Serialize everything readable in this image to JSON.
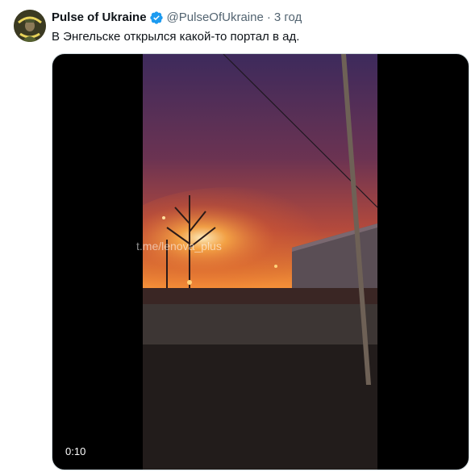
{
  "tweet": {
    "display_name": "Pulse of Ukraine",
    "handle": "@PulseOfUkraine",
    "separator": "·",
    "timestamp": "3 год",
    "verified": true,
    "text": "В Энгельске открылся какой-то портал в ад.",
    "avatar_icon": "soldier-portrait-avatar"
  },
  "media": {
    "type": "video",
    "duration": "0:10",
    "watermark": "t.me/lenova_plus",
    "colors": {
      "sky_top": "#3d2a5c",
      "sky_mid": "#b44a3c",
      "fire_glow": "#ffb347",
      "ground": "#2a2422"
    }
  },
  "colors": {
    "verified_blue": "#1d9bf0",
    "secondary_text": "#536471",
    "primary_text": "#0f1419"
  }
}
